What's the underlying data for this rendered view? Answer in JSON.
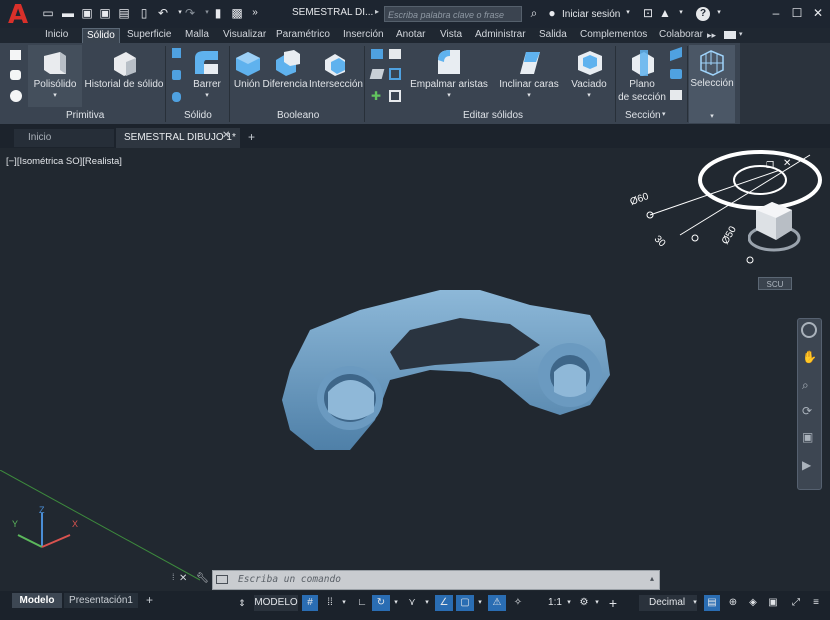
{
  "app": {
    "logo_letter": "A",
    "document_title": "SEMESTRAL DI...",
    "search_placeholder": "Escriba palabra clave o frase",
    "sign_in": "Iniciar sesión",
    "help": "?"
  },
  "ribbon_tabs": [
    "Inicio",
    "Sólido",
    "Superficie",
    "Malla",
    "Visualizar",
    "Paramétrico",
    "Inserción",
    "Anotar",
    "Vista",
    "Administrar",
    "Salida",
    "Complementos",
    "Colaborar"
  ],
  "active_tab": "Sólido",
  "ribbon": {
    "primitiva": {
      "title": "Primitiva",
      "polisolido": "Polisólido",
      "historial": "Historial de sólido"
    },
    "solido": {
      "title": "Sólido",
      "barrer": "Barrer"
    },
    "booleano": {
      "title": "Booleano",
      "union": "Unión",
      "diferencia": "Diferencia",
      "interseccion": "Intersección"
    },
    "editar": {
      "title": "Editar sólidos",
      "empalmar": "Empalmar aristas",
      "inclinar": "Inclinar caras",
      "vaciado": "Vaciado"
    },
    "seccion": {
      "title": "Sección",
      "plano_1": "Plano",
      "plano_2": "de sección"
    },
    "seleccion": {
      "label": "Selección"
    }
  },
  "doc_tabs": {
    "inicio": "Inicio",
    "active": "SEMESTRAL DIBUJO 1*"
  },
  "viewport": {
    "label": "[−][Isométrica SO][Realista]",
    "scu": "SCU",
    "dim_60": "Ø60",
    "dim_50": "Ø50",
    "dim_30": "30"
  },
  "command": {
    "placeholder": "Escriba un comando"
  },
  "statusbar": {
    "layout_model": "Modelo",
    "layout_pres": "Presentación1",
    "model_btn": "MODELO",
    "scale": "1:1",
    "units": "Decimal"
  },
  "colors": {
    "accent": "#2a6db3",
    "logo_red": "#d9302a",
    "part_blue": "#6f9fc4",
    "ribbon_bg": "#3a4451"
  }
}
